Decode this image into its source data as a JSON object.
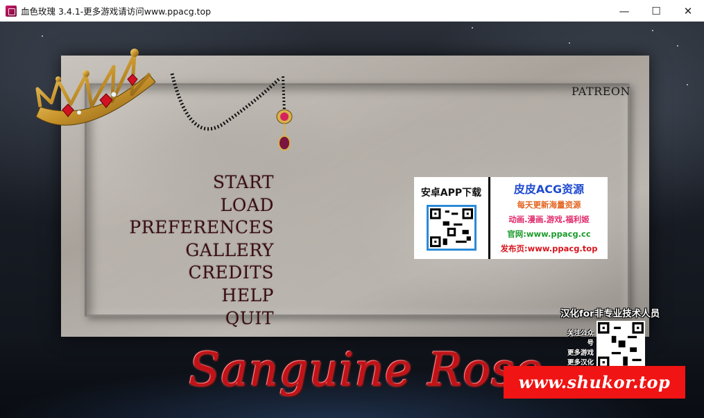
{
  "window": {
    "title": "血色玫瑰 3.4.1-更多游戏请访问www.ppacg.top",
    "minimize": "—",
    "maximize": "☐",
    "close": "✕"
  },
  "menu": {
    "items": [
      {
        "label": "START"
      },
      {
        "label": "LOAD"
      },
      {
        "label": "PREFERENCES"
      },
      {
        "label": "GALLERY"
      },
      {
        "label": "CREDITS"
      },
      {
        "label": "HELP"
      },
      {
        "label": "QUIT"
      }
    ]
  },
  "patreon": "PATREON",
  "ad_banner": {
    "download": "安卓APP下载",
    "brand": "皮皮ACG资源",
    "line1": "每天更新海量资源",
    "line2": "动画.漫画.游戏.福利姬",
    "line3": "官网:www.ppacg.cc",
    "line4": "发布页:www.ppacg.top"
  },
  "watermark": {
    "title": "汉化for非专业技术人员",
    "lines": [
      "关注公众号",
      "更多游戏",
      "更多汉化"
    ]
  },
  "logo": "Sanguine Rose",
  "site_banner": "www.shukor.top",
  "colors": {
    "menu_text": "#3a0d10",
    "logo_red": "#c21218",
    "site_banner_bg": "#f01414"
  }
}
